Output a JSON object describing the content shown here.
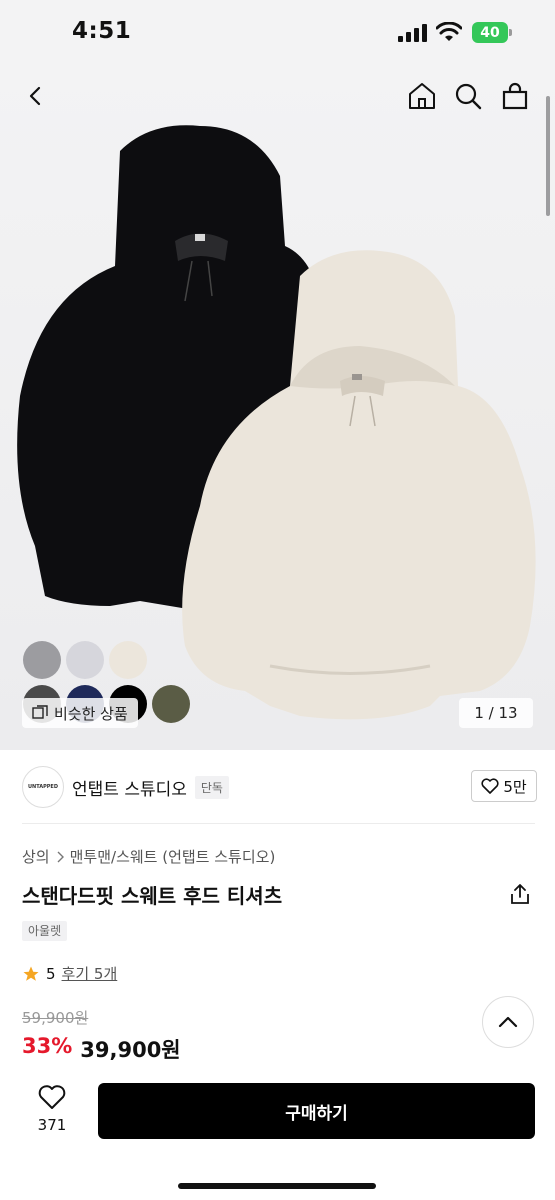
{
  "status_bar": {
    "time": "4:51",
    "battery": "40"
  },
  "gallery": {
    "similar_label": "비슷한 상품",
    "counter": "1 / 13",
    "swatches": [
      "#9c9ca0",
      "#d6d6dc",
      "#ece6dc",
      "#4a4a4a",
      "#1f2a5a",
      "#000000",
      "#5a5c45"
    ]
  },
  "brand": {
    "logo_text": "UNTAPPED",
    "name": "언탭트 스튜디오",
    "badge": "단독",
    "likes": "5만"
  },
  "breadcrumb": {
    "level1": "상의",
    "level2": "맨투맨/스웨트 (언탭트 스튜디오)"
  },
  "product": {
    "title": "스탠다드핏 스웨트 후드 티셔츠",
    "outlet_tag": "아울렛",
    "rating": "5",
    "reviews": "후기 5개",
    "original_price": "59,900원",
    "discount": "33%",
    "price": "39,900원"
  },
  "bottom_bar": {
    "wish_count": "371",
    "buy_label": "구매하기"
  },
  "colors": {
    "accent_red": "#e5192c",
    "star": "#f5a623"
  }
}
